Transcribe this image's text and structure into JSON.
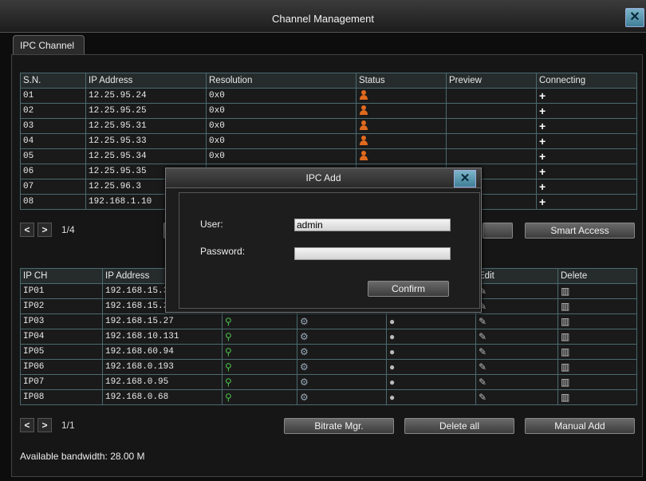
{
  "window": {
    "title": "Channel Management",
    "close_icon": "close-icon"
  },
  "tab": {
    "label": "IPC Channel"
  },
  "top_table": {
    "headers": [
      "S.N.",
      "IP Address",
      "Resolution",
      "Status",
      "Preview",
      "Connecting"
    ],
    "rows": [
      {
        "sn": "01",
        "ip": "12.25.95.24",
        "res": "0x0"
      },
      {
        "sn": "02",
        "ip": "12.25.95.25",
        "res": "0x0"
      },
      {
        "sn": "03",
        "ip": "12.25.95.31",
        "res": "0x0"
      },
      {
        "sn": "04",
        "ip": "12.25.95.33",
        "res": "0x0"
      },
      {
        "sn": "05",
        "ip": "12.25.95.34",
        "res": "0x0"
      },
      {
        "sn": "06",
        "ip": "12.25.95.35",
        "res": ""
      },
      {
        "sn": "07",
        "ip": "12.25.96.3",
        "res": ""
      },
      {
        "sn": "08",
        "ip": "192.168.1.10",
        "res": ""
      }
    ],
    "page": "1/4",
    "smart_access_label": "Smart Access"
  },
  "bottom_table": {
    "headers": [
      "IP CH",
      "IP Address",
      "",
      "",
      "",
      "Edit",
      "Delete"
    ],
    "rows": [
      {
        "ch": "IP01",
        "ip": "192.168.15.31"
      },
      {
        "ch": "IP02",
        "ip": "192.168.15.29"
      },
      {
        "ch": "IP03",
        "ip": "192.168.15.27"
      },
      {
        "ch": "IP04",
        "ip": "192.168.10.131"
      },
      {
        "ch": "IP05",
        "ip": "192.168.60.94"
      },
      {
        "ch": "IP06",
        "ip": "192.168.0.193"
      },
      {
        "ch": "IP07",
        "ip": "192.168.0.95"
      },
      {
        "ch": "IP08",
        "ip": "192.168.0.68"
      }
    ],
    "page": "1/1",
    "bitrate_label": "Bitrate Mgr.",
    "delete_all_label": "Delete all",
    "manual_add_label": "Manual Add"
  },
  "bandwidth": "Available bandwidth: 28.00 M",
  "modal": {
    "title": "IPC Add",
    "user_label": "User:",
    "user_value": "admin",
    "password_label": "Password:",
    "password_value": "",
    "confirm_label": "Confirm"
  },
  "pager_prev": "<",
  "pager_next": ">"
}
